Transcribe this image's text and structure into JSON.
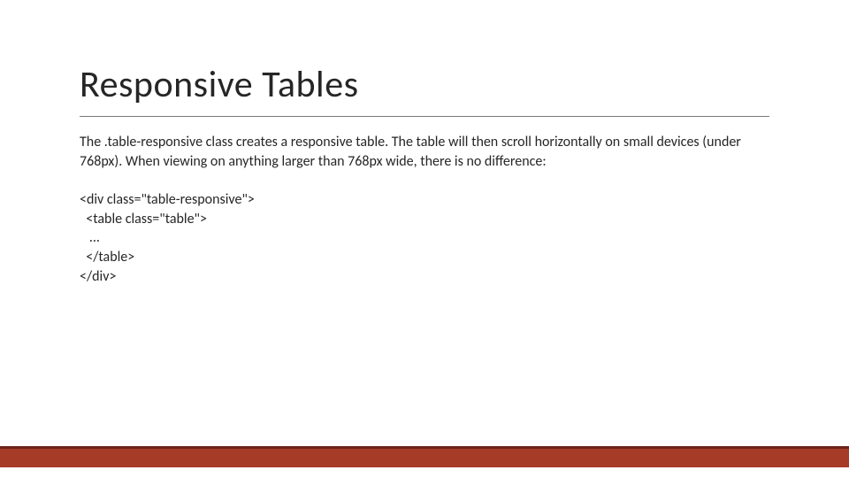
{
  "slide": {
    "title": "Responsive Tables",
    "description": "The .table-responsive class creates a responsive table. The table will then scroll horizontally on small devices (under 768px). When viewing on anything larger than 768px wide, there is no difference:",
    "code": "<div class=\"table-responsive\">\n  <table class=\"table\">\n   ...\n  </table>\n</div>"
  }
}
